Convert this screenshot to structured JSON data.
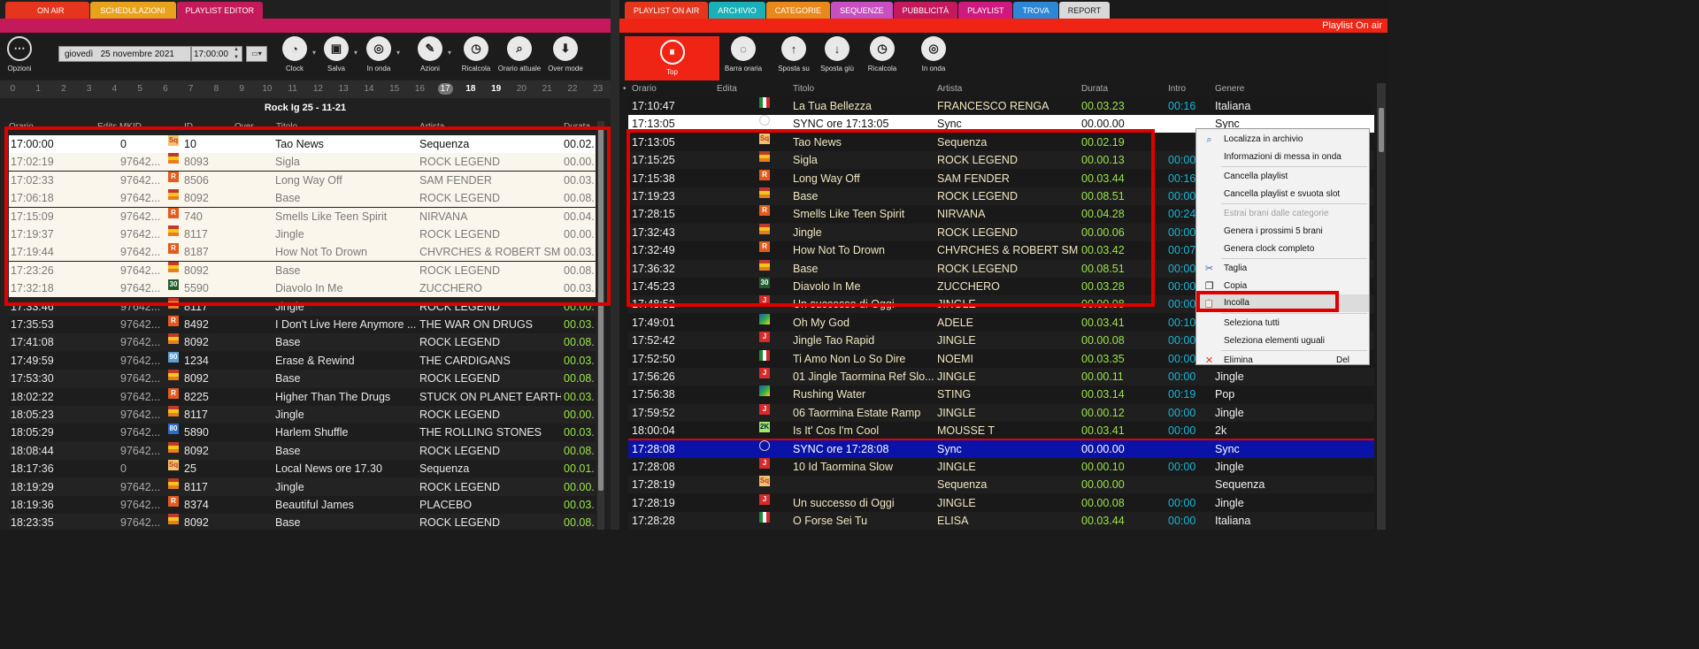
{
  "left": {
    "tabs": [
      {
        "label": "ON AIR",
        "color": "#e5361d"
      },
      {
        "label": "SCHEDULAZIONI",
        "color": "#e9a21b"
      },
      {
        "label": "PLAYLIST EDITOR",
        "color": "#c4195a"
      }
    ],
    "strip_color": "#c4195a",
    "toolbar": {
      "options": "Opzioni",
      "date_day": "giovedì",
      "date": "25 novembre 2021",
      "time": "17:00:00",
      "buttons": [
        {
          "label": "Clock",
          "icon": "clock-icon",
          "glyph": "◔"
        },
        {
          "label": "Salva",
          "icon": "save-icon",
          "glyph": "▣"
        },
        {
          "label": "In onda",
          "icon": "on-air-icon",
          "glyph": "◎"
        },
        {
          "label": "Azioni",
          "icon": "actions-icon",
          "glyph": "✎"
        },
        {
          "label": "Ricalcola",
          "icon": "recalc-icon",
          "glyph": "◷"
        },
        {
          "label": "Orario attuale",
          "icon": "current-time-icon",
          "glyph": "⌕"
        },
        {
          "label": "Over mode",
          "icon": "over-mode-icon",
          "glyph": "⬇"
        }
      ]
    },
    "hours": [
      "0",
      "1",
      "2",
      "3",
      "4",
      "5",
      "6",
      "7",
      "8",
      "9",
      "10",
      "11",
      "12",
      "13",
      "14",
      "15",
      "16",
      "17",
      "18",
      "19",
      "20",
      "21",
      "22",
      "23"
    ],
    "selected_hour": "17",
    "playlist_title": "Rock Ig 25 - 11-21",
    "columns": [
      "Orario",
      "Edits MKID",
      "ID",
      "Over",
      "Titolo",
      "Artista",
      "Durata"
    ],
    "rows": [
      {
        "time": "17:00:00",
        "mkid": "0",
        "icon": "sq",
        "id": "10",
        "title": "Tao News",
        "artist": "Sequenza",
        "dur": "00.02."
      },
      {
        "time": "17:02:19",
        "mkid": "97642...",
        "icon": "flag",
        "id": "8093",
        "title": "Sigla",
        "artist": "ROCK LEGEND",
        "dur": "00.00."
      },
      {
        "time": "17:02:33",
        "mkid": "97642...",
        "icon": "r",
        "id": "8506",
        "title": "Long Way Off",
        "artist": "SAM FENDER",
        "dur": "00.03."
      },
      {
        "time": "17:06:18",
        "mkid": "97642...",
        "icon": "flag",
        "id": "8092",
        "title": "Base",
        "artist": "ROCK LEGEND",
        "dur": "00.08."
      },
      {
        "time": "17:15:09",
        "mkid": "97642...",
        "icon": "r",
        "id": "740",
        "title": "Smells Like Teen Spirit",
        "artist": "NIRVANA",
        "dur": "00.04."
      },
      {
        "time": "17:19:37",
        "mkid": "97642...",
        "icon": "flag",
        "id": "8117",
        "title": "Jingle",
        "artist": "ROCK LEGEND",
        "dur": "00.00."
      },
      {
        "time": "17:19:44",
        "mkid": "97642...",
        "icon": "r",
        "id": "8187",
        "title": "How Not To Drown",
        "artist": "CHVRCHES & ROBERT SM...",
        "dur": "00.03."
      },
      {
        "time": "17:23:26",
        "mkid": "97642...",
        "icon": "flag",
        "id": "8092",
        "title": "Base",
        "artist": "ROCK LEGEND",
        "dur": "00.08."
      },
      {
        "time": "17:32:18",
        "mkid": "97642...",
        "icon": "30",
        "id": "5590",
        "title": "Diavolo In Me",
        "artist": "ZUCCHERO",
        "dur": "00.03."
      },
      {
        "time": "17:33:46",
        "mkid": "97642...",
        "icon": "flag",
        "id": "8117",
        "title": "Jingle",
        "artist": "ROCK LEGEND",
        "dur": "00.00."
      },
      {
        "time": "17:35:53",
        "mkid": "97642...",
        "icon": "r",
        "id": "8492",
        "title": "I Don't Live Here Anymore ...",
        "artist": "THE WAR ON DRUGS",
        "dur": "00.03."
      },
      {
        "time": "17:41:08",
        "mkid": "97642...",
        "icon": "flag",
        "id": "8092",
        "title": "Base",
        "artist": "ROCK LEGEND",
        "dur": "00.08."
      },
      {
        "time": "17:49:59",
        "mkid": "97642...",
        "icon": "90",
        "id": "1234",
        "title": "Erase & Rewind",
        "artist": "THE CARDIGANS",
        "dur": "00.03."
      },
      {
        "time": "17:53:30",
        "mkid": "97642...",
        "icon": "flag",
        "id": "8092",
        "title": "Base",
        "artist": "ROCK LEGEND",
        "dur": "00.08."
      },
      {
        "time": "18:02:22",
        "mkid": "97642...",
        "icon": "r",
        "id": "8225",
        "title": "Higher Than The Drugs",
        "artist": "STUCK ON PLANET EARTH",
        "dur": "00.03."
      },
      {
        "time": "18:05:23",
        "mkid": "97642...",
        "icon": "flag",
        "id": "8117",
        "title": "Jingle",
        "artist": "ROCK LEGEND",
        "dur": "00.00."
      },
      {
        "time": "18:05:29",
        "mkid": "97642...",
        "icon": "80",
        "id": "5890",
        "title": "Harlem Shuffle",
        "artist": "THE ROLLING STONES",
        "dur": "00.03."
      },
      {
        "time": "18:08:44",
        "mkid": "97642...",
        "icon": "flag",
        "id": "8092",
        "title": "Base",
        "artist": "ROCK LEGEND",
        "dur": "00.08."
      },
      {
        "time": "18:17:36",
        "mkid": "0",
        "icon": "sq",
        "id": "25",
        "title": "Local News ore 17.30",
        "artist": "Sequenza",
        "dur": "00.01."
      },
      {
        "time": "18:19:29",
        "mkid": "97642...",
        "icon": "flag",
        "id": "8117",
        "title": "Jingle",
        "artist": "ROCK LEGEND",
        "dur": "00.00."
      },
      {
        "time": "18:19:36",
        "mkid": "97642...",
        "icon": "r",
        "id": "8374",
        "title": "Beautiful James",
        "artist": "PLACEBO",
        "dur": "00.03."
      },
      {
        "time": "18:23:35",
        "mkid": "97642...",
        "icon": "flag",
        "id": "8092",
        "title": "Base",
        "artist": "ROCK LEGEND",
        "dur": "00.08."
      }
    ]
  },
  "right": {
    "tabs": [
      {
        "label": "PLAYLIST ON AIR",
        "color": "#e5361d"
      },
      {
        "label": "ARCHIVIO",
        "color": "#1ab0b8"
      },
      {
        "label": "CATEGORIE",
        "color": "#e9891b"
      },
      {
        "label": "SEQUENZE",
        "color": "#c84fbf"
      },
      {
        "label": "PUBBLICITÀ",
        "color": "#c4195a"
      },
      {
        "label": "PLAYLIST",
        "color": "#d0197f"
      },
      {
        "label": "TROVA",
        "color": "#2d86d6"
      },
      {
        "label": "REPORT",
        "color": "#d9d9d9"
      }
    ],
    "strip_color": "#f02414",
    "strip_title": "Playlist On air",
    "toolbar": {
      "top": "Top",
      "buttons": [
        {
          "label": "Barra oraria",
          "icon": "time-bar-icon",
          "glyph": "◌"
        },
        {
          "label": "Sposta su",
          "icon": "move-up-icon",
          "glyph": "↑"
        },
        {
          "label": "Sposta giù",
          "icon": "move-down-icon",
          "glyph": "↓"
        },
        {
          "label": "Ricalcola",
          "icon": "recalc-icon",
          "glyph": "◷"
        },
        {
          "label": "In onda",
          "icon": "on-air-icon",
          "glyph": "◎"
        }
      ]
    },
    "columns": [
      "Orario",
      "Edita",
      "Titolo",
      "Artista",
      "Durata",
      "Intro",
      "Genere"
    ],
    "rows": [
      {
        "time": "17:10:47",
        "icon": "it",
        "title": "La Tua Bellezza",
        "artist": "FRANCESCO RENGA",
        "dur": "00.03.23",
        "intro": "00:16",
        "genre": "Italiana",
        "style": "normal"
      },
      {
        "time": "17:13:05",
        "icon": "clock",
        "title": "SYNC ore 17:13:05",
        "artist": "Sync",
        "dur": "00.00.00",
        "intro": "",
        "genre": "Sync",
        "style": "white"
      },
      {
        "time": "17:13:05",
        "icon": "sq",
        "title": "Tao News",
        "artist": "Sequenza",
        "dur": "00.02.19",
        "intro": "",
        "genre": "",
        "style": "normal"
      },
      {
        "time": "17:15:25",
        "icon": "flag",
        "title": "Sigla",
        "artist": "ROCK LEGEND",
        "dur": "00.00.13",
        "intro": "00:00",
        "genre": "",
        "style": "normal"
      },
      {
        "time": "17:15:38",
        "icon": "r",
        "title": "Long Way Off",
        "artist": "SAM FENDER",
        "dur": "00.03.44",
        "intro": "00:16",
        "genre": "",
        "style": "normal"
      },
      {
        "time": "17:19:23",
        "icon": "flag",
        "title": "Base",
        "artist": "ROCK LEGEND",
        "dur": "00.08.51",
        "intro": "00:00",
        "genre": "",
        "style": "normal"
      },
      {
        "time": "17:28:15",
        "icon": "r",
        "title": "Smells Like Teen Spirit",
        "artist": "NIRVANA",
        "dur": "00.04.28",
        "intro": "00:24",
        "genre": "",
        "style": "normal"
      },
      {
        "time": "17:32:43",
        "icon": "flag",
        "title": "Jingle",
        "artist": "ROCK LEGEND",
        "dur": "00.00.06",
        "intro": "00:00",
        "genre": "",
        "style": "normal"
      },
      {
        "time": "17:32:49",
        "icon": "r",
        "title": "How Not To Drown",
        "artist": "CHVRCHES & ROBERT SM...",
        "dur": "00.03.42",
        "intro": "00:07",
        "genre": "",
        "style": "normal"
      },
      {
        "time": "17:36:32",
        "icon": "flag",
        "title": "Base",
        "artist": "ROCK LEGEND",
        "dur": "00.08.51",
        "intro": "00:00",
        "genre": "",
        "style": "normal"
      },
      {
        "time": "17:45:23",
        "icon": "30",
        "title": "Diavolo In Me",
        "artist": "ZUCCHERO",
        "dur": "00.03.28",
        "intro": "00:00",
        "genre": "",
        "style": "normal"
      },
      {
        "time": "17:48:52",
        "icon": "j",
        "title": "Un successo di Oggi",
        "artist": "JINGLE",
        "dur": "00.00.08",
        "intro": "00:00",
        "genre": "",
        "style": "strike"
      },
      {
        "time": "17:49:01",
        "icon": "rainbow",
        "title": "Oh My God",
        "artist": "ADELE",
        "dur": "00.03.41",
        "intro": "00:10",
        "genre": "",
        "style": "normal"
      },
      {
        "time": "17:52:42",
        "icon": "j",
        "title": "Jingle Tao Rapid",
        "artist": "JINGLE",
        "dur": "00.00.08",
        "intro": "00:00",
        "genre": "",
        "style": "normal"
      },
      {
        "time": "17:52:50",
        "icon": "it",
        "title": "Ti Amo Non Lo So Dire",
        "artist": "NOEMI",
        "dur": "00.03.35",
        "intro": "00:00",
        "genre": "",
        "style": "normal"
      },
      {
        "time": "17:56:26",
        "icon": "j",
        "title": "01 Jingle Taormina Ref Slo...",
        "artist": "JINGLE",
        "dur": "00.00.11",
        "intro": "00:00",
        "genre": "Jingle",
        "style": "normal"
      },
      {
        "time": "17:56:38",
        "icon": "rainbow",
        "title": "Rushing Water",
        "artist": "STING",
        "dur": "00.03.14",
        "intro": "00:19",
        "genre": "Pop",
        "style": "normal"
      },
      {
        "time": "17:59:52",
        "icon": "j",
        "title": "06 Taormina Estate Ramp",
        "artist": "JINGLE",
        "dur": "00.00.12",
        "intro": "00:00",
        "genre": "Jingle",
        "style": "normal"
      },
      {
        "time": "18:00:04",
        "icon": "2k",
        "title": "Is It' Cos I'm Cool",
        "artist": "MOUSSE T",
        "dur": "00.03.41",
        "intro": "00:00",
        "genre": "2k",
        "style": "normal"
      },
      {
        "time": "17:28:08",
        "icon": "clock",
        "title": "SYNC ore 17:28:08",
        "artist": "Sync",
        "dur": "00.00.00",
        "intro": "",
        "genre": "Sync",
        "style": "blue"
      },
      {
        "time": "17:28:08",
        "icon": "j",
        "title": "10 Id Taormina Slow",
        "artist": "JINGLE",
        "dur": "00.00.10",
        "intro": "00:00",
        "genre": "Jingle",
        "style": "normal"
      },
      {
        "time": "17:28:19",
        "icon": "sq",
        "title": "",
        "artist": "Sequenza",
        "dur": "00.00.00",
        "intro": "",
        "genre": "Sequenza",
        "style": "normal"
      },
      {
        "time": "17:28:19",
        "icon": "j",
        "title": "Un successo di Oggi",
        "artist": "JINGLE",
        "dur": "00.00.08",
        "intro": "00:00",
        "genre": "Jingle",
        "style": "normal"
      },
      {
        "time": "17:28:28",
        "icon": "it",
        "title": "O Forse Sei Tu",
        "artist": "ELISA",
        "dur": "00.03.44",
        "intro": "00:00",
        "genre": "Italiana",
        "style": "normal"
      }
    ],
    "context_menu": [
      {
        "label": "Localizza in archivio",
        "icon": "locate-icon",
        "glyph": "⌕",
        "enabled": true
      },
      {
        "label": "Informazioni di messa in onda",
        "icon": "",
        "glyph": "",
        "enabled": true
      },
      {
        "sep": true
      },
      {
        "label": "Cancella playlist",
        "icon": "",
        "glyph": "",
        "enabled": true
      },
      {
        "label": "Cancella playlist e svuota slot",
        "icon": "",
        "glyph": "",
        "enabled": true
      },
      {
        "sep": true
      },
      {
        "label": "Estrai brani dalle categorie",
        "icon": "",
        "glyph": "",
        "enabled": false
      },
      {
        "label": "Genera i prossimi 5 brani",
        "icon": "",
        "glyph": "",
        "enabled": true
      },
      {
        "label": "Genera clock completo",
        "icon": "",
        "glyph": "",
        "enabled": true
      },
      {
        "sep": true
      },
      {
        "label": "Taglia",
        "icon": "scissors-icon",
        "glyph": "✂",
        "enabled": true
      },
      {
        "label": "Copia",
        "icon": "copy-icon",
        "glyph": "❐",
        "enabled": true
      },
      {
        "label": "Incolla",
        "icon": "paste-icon",
        "glyph": "📋",
        "enabled": true,
        "highlight": true
      },
      {
        "sep": true
      },
      {
        "label": "Seleziona tutti",
        "icon": "",
        "glyph": "",
        "enabled": true
      },
      {
        "label": "Seleziona elementi uguali",
        "icon": "",
        "glyph": "",
        "enabled": true
      },
      {
        "sep": true
      },
      {
        "label": "Elimina",
        "icon": "delete-icon",
        "glyph": "✕",
        "enabled": true,
        "shortcut": "Del"
      }
    ]
  },
  "colors": {
    "green_duration": "#9be34a",
    "cyan_intro": "#18b6d6",
    "annotation_red": "#e00000",
    "on_air_blue": "#0a12a8"
  }
}
